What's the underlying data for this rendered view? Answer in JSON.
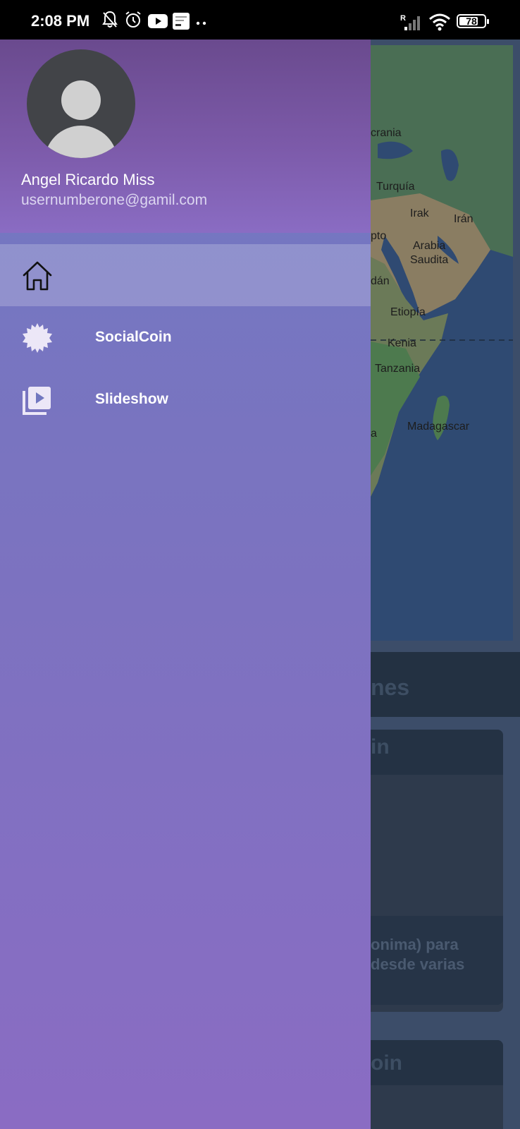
{
  "status_bar": {
    "time": "2:08 PM",
    "battery": "78",
    "battery_level_pct": 78,
    "icons": [
      "bell-off-icon",
      "alarm-icon",
      "youtube-icon",
      "notification-icon",
      "more-dots-icon",
      "signal-icon",
      "wifi-icon",
      "battery-icon"
    ]
  },
  "drawer": {
    "user_name": "Angel Ricardo Miss",
    "user_email": "usernumberone@gamil.com",
    "items": [
      {
        "label": "",
        "icon": "home-icon",
        "selected": true
      },
      {
        "label": "SocialCoin",
        "icon": "socialcoin-icon",
        "selected": false
      },
      {
        "label": "Slideshow",
        "icon": "slideshow-icon",
        "selected": false
      }
    ],
    "colors": {
      "header_top": "#6a4a8e",
      "body": "#7b73c0",
      "selected_overlay": "rgba(255,255,255,0.2)"
    }
  },
  "background": {
    "map_labels": [
      "crania",
      "Turquía",
      "Irak",
      "Irán",
      "pto",
      "Arabia",
      "Saudita",
      "dán",
      "Etiopía",
      "Kenia",
      "Tanzania",
      "Madagascar",
      "a"
    ],
    "section_title": "nes",
    "card1": {
      "title": "in",
      "text_line1": "onima) para",
      "text_line2": "desde varias"
    },
    "card2": {
      "title": "oin"
    }
  }
}
